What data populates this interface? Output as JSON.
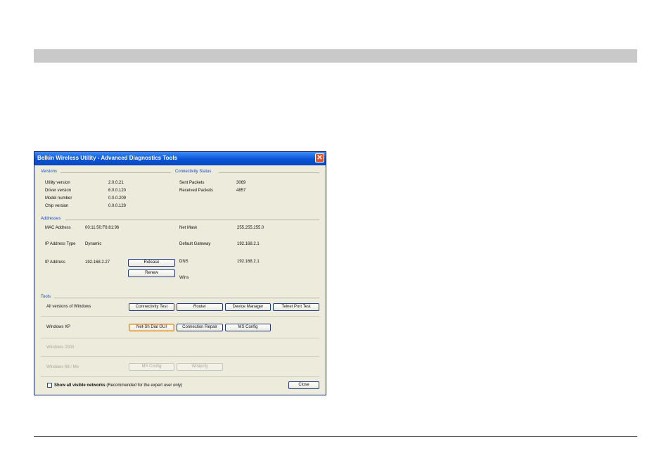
{
  "window": {
    "title": "Belkin Wireless Utility - Advanced Diagnostics Tools",
    "close_glyph": "✕"
  },
  "versions": {
    "heading": "Versions",
    "rows": [
      {
        "label": "Utility version",
        "value": "2.0.0.21"
      },
      {
        "label": "Driver version",
        "value": "6.0.0.120"
      },
      {
        "label": "Model number",
        "value": "0.0.0.209"
      },
      {
        "label": "Chip version",
        "value": "0.0.0.129"
      }
    ]
  },
  "connectivity": {
    "heading": "Connectivity Status",
    "rows": [
      {
        "label": "Sent Packets",
        "value": "3069"
      },
      {
        "label": "Received Packets",
        "value": "4857"
      }
    ]
  },
  "addresses": {
    "heading": "Addresses",
    "mac_label": "MAC Address",
    "mac_value": "00:11:50:F6:81:96",
    "ip_type_label": "IP Address Type",
    "ip_type_value": "Dynamic",
    "ip_label": "IP Address",
    "ip_value": "192.168.2.27",
    "release_label": "Release",
    "renew_label": "Renew",
    "netmask_label": "Net Mask",
    "netmask_value": "255.255.255.0",
    "gateway_label": "Default Gateway",
    "gateway_value": "192.168.2.1",
    "dns_label": "DNS",
    "dns_value": "192.168.2.1",
    "wins_label": "Wins"
  },
  "tools": {
    "heading": "Tools",
    "all_label": "All versions of Windows",
    "all_buttons": [
      "Connectivity Test",
      "Router",
      "Device Manager",
      "Telnet Port Test"
    ],
    "xp_label": "Windows XP",
    "xp_buttons": [
      "Net-Sh Dial GUI",
      "Connection Repair",
      "MS Config"
    ],
    "w2000_label": "Windows 2000",
    "w98_label": "Windows 98 / Me",
    "w98_buttons": [
      "MS Config",
      "Winipcfg"
    ]
  },
  "footer": {
    "checkbox_bold": "Show all visible networks",
    "checkbox_note": "(Recommended for the expert user only)",
    "close_label": "Close"
  }
}
